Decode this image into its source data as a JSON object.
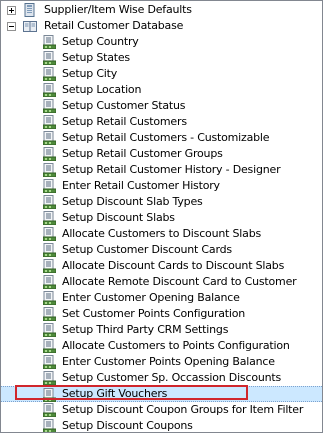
{
  "tree": {
    "nodes": [
      {
        "label": "Supplier/Item Wise Defaults",
        "level": 0,
        "expander": "plus",
        "icon": "database-icon"
      },
      {
        "label": "Retail Customer Database",
        "level": 0,
        "expander": "minus",
        "icon": "book-folder-icon"
      },
      {
        "label": "Setup Country",
        "level": 1,
        "icon": "document-item-icon"
      },
      {
        "label": "Setup States",
        "level": 1,
        "icon": "document-item-icon"
      },
      {
        "label": "Setup City",
        "level": 1,
        "icon": "document-item-icon"
      },
      {
        "label": "Setup Location",
        "level": 1,
        "icon": "document-item-icon"
      },
      {
        "label": "Setup Customer Status",
        "level": 1,
        "icon": "document-item-icon"
      },
      {
        "label": "Setup Retail Customers",
        "level": 1,
        "icon": "document-item-icon"
      },
      {
        "label": "Setup Retail Customers - Customizable",
        "level": 1,
        "icon": "document-item-icon"
      },
      {
        "label": "Setup Retail Customer Groups",
        "level": 1,
        "icon": "document-item-icon"
      },
      {
        "label": "Setup Retail Customer History - Designer",
        "level": 1,
        "icon": "document-item-icon"
      },
      {
        "label": "Enter Retail Customer History",
        "level": 1,
        "icon": "document-item-icon"
      },
      {
        "label": "Setup Discount Slab Types",
        "level": 1,
        "icon": "document-item-icon"
      },
      {
        "label": "Setup Discount Slabs",
        "level": 1,
        "icon": "document-item-icon"
      },
      {
        "label": "Allocate Customers to Discount Slabs",
        "level": 1,
        "icon": "document-item-icon"
      },
      {
        "label": "Setup Customer Discount Cards",
        "level": 1,
        "icon": "document-item-icon"
      },
      {
        "label": "Allocate Discount Cards to Discount Slabs",
        "level": 1,
        "icon": "document-item-icon"
      },
      {
        "label": "Allocate Remote Discount Card to Customer",
        "level": 1,
        "icon": "document-item-icon"
      },
      {
        "label": "Enter Customer Opening Balance",
        "level": 1,
        "icon": "document-item-icon"
      },
      {
        "label": "Set Customer Points Configuration",
        "level": 1,
        "icon": "document-item-icon"
      },
      {
        "label": "Setup Third Party CRM Settings",
        "level": 1,
        "icon": "document-item-icon"
      },
      {
        "label": "Allocate Customers to Points Configuration",
        "level": 1,
        "icon": "document-item-icon"
      },
      {
        "label": "Enter Customer Points Opening Balance",
        "level": 1,
        "icon": "document-item-icon"
      },
      {
        "label": "Setup Customer Sp. Occassion Discounts",
        "level": 1,
        "icon": "document-item-icon"
      },
      {
        "label": "Setup Gift Vouchers",
        "level": 1,
        "icon": "document-item-icon",
        "selected": true
      },
      {
        "label": "Setup Discount Coupon Groups for Item Filter",
        "level": 1,
        "icon": "document-item-icon"
      },
      {
        "label": "Setup Discount Coupons",
        "level": 1,
        "icon": "document-item-icon"
      }
    ]
  },
  "colors": {
    "selection_bg": "#cce8ff",
    "highlight_border": "#d0262c",
    "frame_border": "#828790"
  }
}
